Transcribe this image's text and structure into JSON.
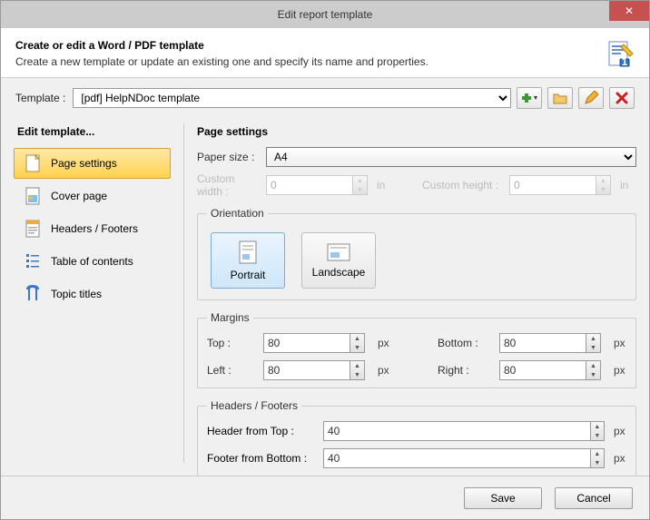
{
  "window": {
    "title": "Edit report template"
  },
  "header": {
    "title": "Create or edit a Word / PDF template",
    "subtitle": "Create a new template or update an existing one and specify its name and properties."
  },
  "toolbar": {
    "template_label": "Template :",
    "template_value": "[pdf] HelpNDoc template"
  },
  "sidebar": {
    "title": "Edit template...",
    "items": [
      {
        "label": "Page settings",
        "icon": "page-settings-icon"
      },
      {
        "label": "Cover page",
        "icon": "cover-page-icon"
      },
      {
        "label": "Headers / Footers",
        "icon": "headers-footers-icon"
      },
      {
        "label": "Table of contents",
        "icon": "toc-icon"
      },
      {
        "label": "Topic titles",
        "icon": "topic-titles-icon"
      }
    ]
  },
  "page_settings": {
    "title": "Page settings",
    "paper_size_label": "Paper size :",
    "paper_size_value": "A4",
    "custom_width_label": "Custom width :",
    "custom_width_value": "0",
    "custom_height_label": "Custom height :",
    "custom_height_value": "0",
    "custom_unit": "in",
    "orientation": {
      "legend": "Orientation",
      "portrait": "Portrait",
      "landscape": "Landscape",
      "selected": "portrait"
    },
    "margins": {
      "legend": "Margins",
      "top_label": "Top :",
      "top_value": "80",
      "bottom_label": "Bottom :",
      "bottom_value": "80",
      "left_label": "Left :",
      "left_value": "80",
      "right_label": "Right :",
      "right_value": "80",
      "unit": "px"
    },
    "hf": {
      "legend": "Headers / Footers",
      "header_label": "Header from Top :",
      "header_value": "40",
      "footer_label": "Footer from Bottom :",
      "footer_value": "40",
      "unit": "px"
    }
  },
  "buttons": {
    "save": "Save",
    "cancel": "Cancel"
  }
}
